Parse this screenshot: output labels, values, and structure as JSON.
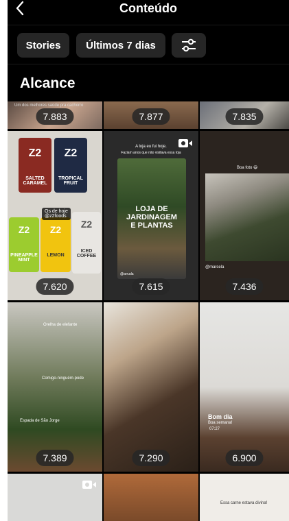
{
  "header": {
    "title": "Conteúdo",
    "back_icon": "chevron-left-icon"
  },
  "filters": {
    "stories": "Stories",
    "period": "Últimos 7 dias",
    "settings_icon": "sliders-icon"
  },
  "section": {
    "title": "Alcance"
  },
  "tiles": [
    {
      "count": "7.883",
      "caption": "Um dos melhores saúde pra cachorro"
    },
    {
      "count": "7.877"
    },
    {
      "count": "7.835"
    },
    {
      "count": "7.620",
      "tag1": "Os de hoje",
      "tag2": "@z2foods",
      "pouches": [
        "SALTED CARAMEL",
        "TROPICAL FRUIT",
        "PINEAPPLE MINT",
        "LEMON",
        "ICED COFFEE"
      ]
    },
    {
      "count": "7.615",
      "text1": "A loja eu fui hoje.",
      "text2": "Faziam anos que não visitava essa loja",
      "overlay": "LOJA DE JARDINAGEM E PLANTAS",
      "handle": "@arruda",
      "reel_icon": "reels-icon"
    },
    {
      "count": "7.436",
      "text1": "Boa foto 😄",
      "handle": "@marcela"
    },
    {
      "count": "7.389",
      "text1": "Orelha de elefante",
      "text2": "Comigo-ninguém-pode",
      "text3": "Espada de São Jorge"
    },
    {
      "count": "7.290"
    },
    {
      "count": "6.900",
      "text1": "Bom dia",
      "text2": "Boa semana!",
      "text3": "07:27"
    },
    {
      "reel_icon": "reels-icon"
    },
    {},
    {
      "text1": "Essa carne estava divina!"
    }
  ],
  "colors": {
    "background": "#000000",
    "chip": "#262626",
    "badge": "#262626"
  }
}
